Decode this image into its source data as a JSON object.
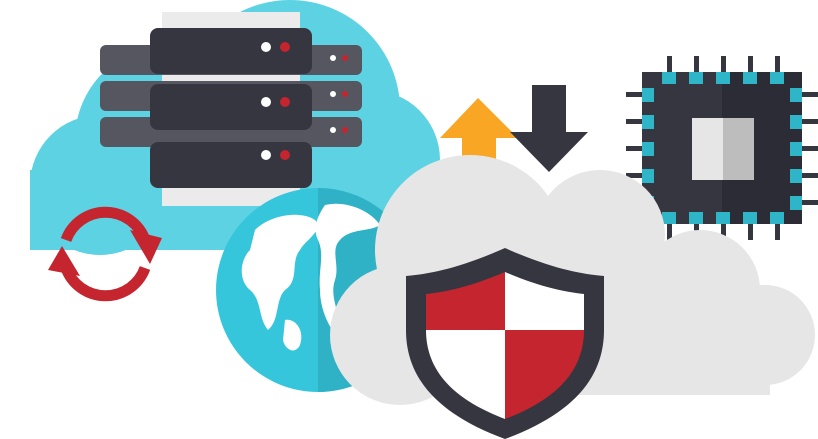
{
  "scene": {
    "description_icons": [
      "blue-cloud",
      "server-rack",
      "sync-arrows",
      "globe",
      "upload-arrow",
      "download-arrow",
      "microchip",
      "gray-cloud",
      "security-shield"
    ]
  },
  "colors": {
    "cloud_blue": "#5dd2e3",
    "cloud_gray": "#e6e6e6",
    "server_dark": "#353640",
    "server_side": "#55565f",
    "led_white": "#ffffff",
    "led_red": "#c4252f",
    "sync_red": "#c4252f",
    "globe_ocean": "#36c6db",
    "globe_land": "#ffffff",
    "arrow_up": "#f9a625",
    "arrow_down": "#353640",
    "chip_body": "#353640",
    "chip_pads": "#2eb6c8",
    "shield_outline": "#353640",
    "shield_red": "#c4252f",
    "shield_white": "#ffffff"
  }
}
